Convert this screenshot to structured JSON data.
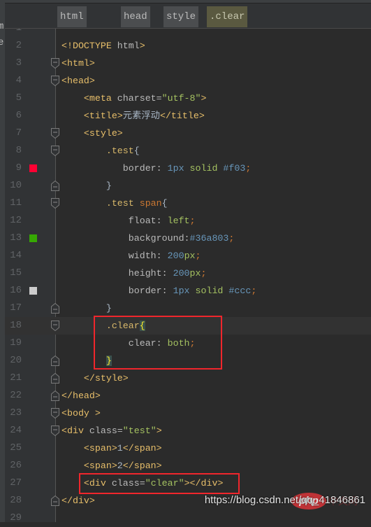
{
  "left_fragments": [
    "m",
    "e"
  ],
  "breadcrumbs": [
    {
      "label": "html",
      "active": false
    },
    {
      "label": "head",
      "active": false
    },
    {
      "label": "style",
      "active": false
    },
    {
      "label": ".clear",
      "active": true
    }
  ],
  "current_line": 18,
  "lines": [
    {
      "n": 1,
      "tokens": []
    },
    {
      "n": 2,
      "tokens": [
        [
          "<!DOCTYPE ",
          "t"
        ],
        [
          "html",
          "a"
        ],
        [
          ">",
          "t"
        ]
      ]
    },
    {
      "n": 3,
      "fold": "start",
      "tokens": [
        [
          "<html>",
          "t"
        ]
      ]
    },
    {
      "n": 4,
      "fold": "start",
      "tokens": [
        [
          "<head>",
          "t"
        ]
      ]
    },
    {
      "n": 5,
      "tokens": [
        [
          "    <meta ",
          "t"
        ],
        [
          "charset=",
          "a"
        ],
        [
          "\"utf-8\"",
          "s"
        ],
        [
          ">",
          "t"
        ]
      ]
    },
    {
      "n": 6,
      "tokens": [
        [
          "    <title>",
          "t"
        ],
        [
          "元素浮动",
          "p"
        ],
        [
          "</title>",
          "t"
        ]
      ]
    },
    {
      "n": 7,
      "fold": "start",
      "tokens": [
        [
          "    <style>",
          "t"
        ]
      ]
    },
    {
      "n": 8,
      "fold": "start",
      "tokens": [
        [
          "        .test",
          "sel"
        ],
        [
          "{",
          "p"
        ]
      ]
    },
    {
      "n": 9,
      "marker": "#ff0033",
      "tokens": [
        [
          "           border: ",
          "a"
        ],
        [
          "1px ",
          "n"
        ],
        [
          "solid ",
          "k"
        ],
        [
          "#f03",
          "n"
        ],
        [
          ";",
          "sc"
        ]
      ]
    },
    {
      "n": 10,
      "fold": "end",
      "tokens": [
        [
          "        }",
          "p"
        ]
      ]
    },
    {
      "n": 11,
      "fold": "start",
      "tokens": [
        [
          "        .test ",
          "sel"
        ],
        [
          "span",
          "ts"
        ],
        [
          "{",
          "p"
        ]
      ]
    },
    {
      "n": 12,
      "tokens": [
        [
          "            float: ",
          "a"
        ],
        [
          "left",
          "k"
        ],
        [
          ";",
          "sc"
        ]
      ]
    },
    {
      "n": 13,
      "marker": "#36a803",
      "tokens": [
        [
          "            background:",
          "a"
        ],
        [
          "#36a803",
          "n"
        ],
        [
          ";",
          "sc"
        ]
      ]
    },
    {
      "n": 14,
      "tokens": [
        [
          "            width: ",
          "a"
        ],
        [
          "200",
          "n"
        ],
        [
          "px",
          "k"
        ],
        [
          ";",
          "sc"
        ]
      ]
    },
    {
      "n": 15,
      "tokens": [
        [
          "            height: ",
          "a"
        ],
        [
          "200",
          "n"
        ],
        [
          "px",
          "k"
        ],
        [
          ";",
          "sc"
        ]
      ]
    },
    {
      "n": 16,
      "marker": "#cccccc",
      "tokens": [
        [
          "            border: ",
          "a"
        ],
        [
          "1px ",
          "n"
        ],
        [
          "solid ",
          "k"
        ],
        [
          "#ccc",
          "n"
        ],
        [
          ";",
          "sc"
        ]
      ]
    },
    {
      "n": 17,
      "fold": "end",
      "tokens": [
        [
          "        }",
          "p"
        ]
      ]
    },
    {
      "n": 18,
      "fold": "start",
      "tokens": [
        [
          "        .clear",
          "sel"
        ],
        [
          "{",
          "hb"
        ]
      ]
    },
    {
      "n": 19,
      "tokens": [
        [
          "            clear: ",
          "a"
        ],
        [
          "both",
          "k"
        ],
        [
          ";",
          "sc"
        ]
      ]
    },
    {
      "n": 20,
      "fold": "end",
      "tokens": [
        [
          "        ",
          "p"
        ],
        [
          "}",
          "hb"
        ]
      ]
    },
    {
      "n": 21,
      "fold": "end",
      "tokens": [
        [
          "    </style>",
          "t"
        ]
      ]
    },
    {
      "n": 22,
      "fold": "end",
      "tokens": [
        [
          "</head>",
          "t"
        ]
      ]
    },
    {
      "n": 23,
      "fold": "start",
      "tokens": [
        [
          "<body >",
          "t"
        ]
      ]
    },
    {
      "n": 24,
      "fold": "start",
      "tokens": [
        [
          "<div ",
          "t"
        ],
        [
          "class=",
          "a"
        ],
        [
          "\"test\"",
          "s"
        ],
        [
          ">",
          "t"
        ]
      ]
    },
    {
      "n": 25,
      "tokens": [
        [
          "    <span>",
          "t"
        ],
        [
          "1",
          "p"
        ],
        [
          "</span>",
          "t"
        ]
      ]
    },
    {
      "n": 26,
      "tokens": [
        [
          "    <span>",
          "t"
        ],
        [
          "2",
          "p"
        ],
        [
          "</span>",
          "t"
        ]
      ]
    },
    {
      "n": 27,
      "tokens": [
        [
          "    <div ",
          "t"
        ],
        [
          "class=",
          "a"
        ],
        [
          "\"clear\"",
          "s"
        ],
        [
          "></div>",
          "t"
        ]
      ]
    },
    {
      "n": 28,
      "fold": "end",
      "tokens": [
        [
          "</div>",
          "t"
        ]
      ]
    },
    {
      "n": 29,
      "tokens": []
    }
  ],
  "watermark": {
    "logo": "php",
    "logo_cn": "中文网",
    "url": "https://blog.csdn.net/qq_41846861"
  }
}
